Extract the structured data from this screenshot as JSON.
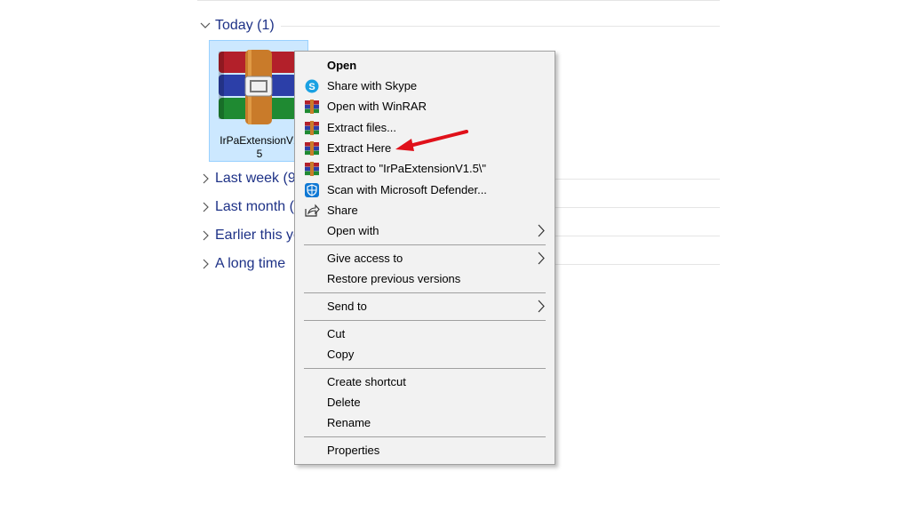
{
  "groups": [
    {
      "label": "Today (1)"
    },
    {
      "label": "Last week (9"
    },
    {
      "label": "Last month ("
    },
    {
      "label": "Earlier this ye"
    },
    {
      "label": "A long time"
    }
  ],
  "file": {
    "name_line1": "IrPaExtensionV1",
    "name_line2": "5",
    "icon": "winrar-archive-icon"
  },
  "context_menu": {
    "items": [
      {
        "label": "Open",
        "icon": null
      },
      {
        "label": "Share with Skype",
        "icon": "skype-icon"
      },
      {
        "label": "Open with WinRAR",
        "icon": "winrar-icon"
      },
      {
        "label": "Extract files...",
        "icon": "winrar-icon"
      },
      {
        "label": "Extract Here",
        "icon": "winrar-icon"
      },
      {
        "label": "Extract to \"IrPaExtensionV1.5\\\"",
        "icon": "winrar-icon"
      },
      {
        "label": "Scan with Microsoft Defender...",
        "icon": "defender-icon"
      },
      {
        "label": "Share",
        "icon": "share-icon"
      },
      {
        "label": "Open with",
        "icon": null,
        "submenu": true
      },
      {
        "label": "Give access to",
        "icon": null,
        "submenu": true
      },
      {
        "label": "Restore previous versions",
        "icon": null
      },
      {
        "label": "Send to",
        "icon": null,
        "submenu": true
      },
      {
        "label": "Cut",
        "icon": null
      },
      {
        "label": "Copy",
        "icon": null
      },
      {
        "label": "Create shortcut",
        "icon": null
      },
      {
        "label": "Delete",
        "icon": null
      },
      {
        "label": "Rename",
        "icon": null
      },
      {
        "label": "Properties",
        "icon": null
      }
    ]
  },
  "colors": {
    "group_label": "#1e3287",
    "selection": "#cce8ff",
    "annotation_arrow": "#e0111a"
  }
}
